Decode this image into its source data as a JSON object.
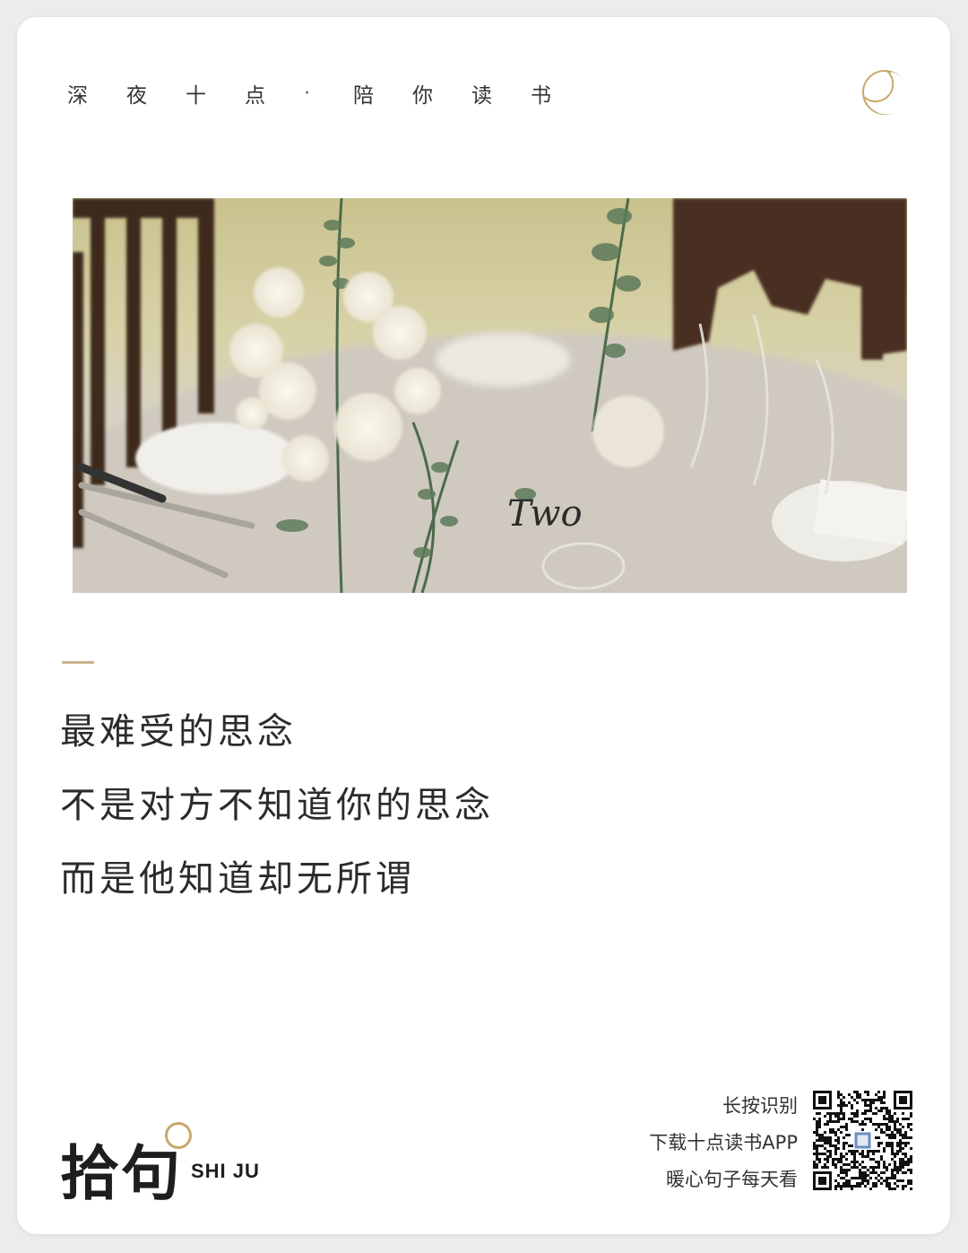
{
  "header": {
    "chars_left": [
      "深",
      "夜",
      "十",
      "点"
    ],
    "separator": "·",
    "chars_right": [
      "陪",
      "你",
      "读",
      "书"
    ]
  },
  "icons": {
    "moon": "crescent-moon-icon",
    "qr": "qr-code-icon"
  },
  "photo": {
    "placard_text": "Two"
  },
  "quote": {
    "lines": [
      "最难受的思念",
      "不是对方不知道你的思念",
      "而是他知道却无所谓"
    ]
  },
  "brand": {
    "name_cn": "拾句",
    "name_en": "SHI JU"
  },
  "promo": {
    "line1": "长按识别",
    "line2": "下载十点读书APP",
    "line3": "暖心句子每天看"
  },
  "colors": {
    "accent": "#c8b48a",
    "brand_ring": "#c8a86a",
    "text": "#2b2b2b"
  }
}
